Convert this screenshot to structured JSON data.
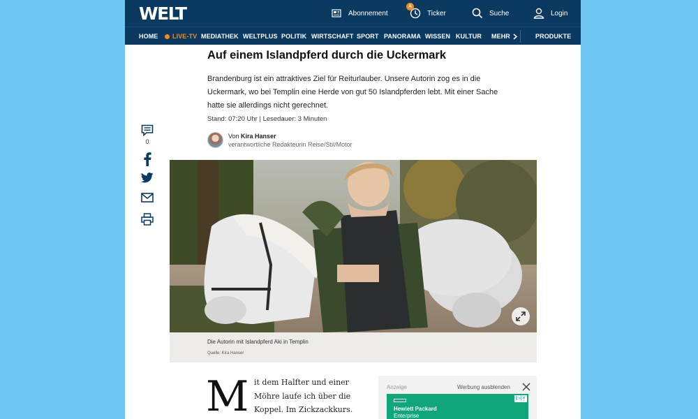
{
  "header": {
    "logo": "WELT",
    "abo_label": "Abonnement",
    "ticker_label": "Ticker",
    "ticker_badge": "A",
    "search_label": "Suche",
    "login_label": "Login"
  },
  "nav": {
    "items": [
      "HOME",
      "LIVE-TV",
      "MEDIATHEK",
      "WELTPLUS",
      "POLITIK",
      "WIRTSCHAFT",
      "SPORT",
      "PANORAMA",
      "WISSEN",
      "KULTUR"
    ],
    "more_label": "MEHR",
    "products_label": "PRODUKTE"
  },
  "article": {
    "headline": "Auf einem Islandpferd durch die Uckermark",
    "intro": "Brandenburg ist ein attraktives Ziel für Reiturlauber. Unsere Autorin zog es in die Uckermark, wo bei Templin eine Herde von gut 50 Islandpferden lebt. Mit einer Sache hatte sie allerdings nicht gerechnet.",
    "meta": "Stand: 07:20 Uhr | Lesedauer: 3 Minuten",
    "author_prefix": "Von",
    "author_name": "Kira Hanser",
    "author_role": "verantwortliche Redakteurin Reise/Stil/Motor",
    "caption": "Die Autorin mit Islandpferd Aki in Templin",
    "credit": "Quelle: Kira Hanser",
    "dropcap": "M",
    "body": "it dem Halfter und einer Möhre laufe ich über die Koppel. Im Zickzackkurs."
  },
  "share": {
    "comment_count": "0"
  },
  "ad": {
    "label": "Anzeige",
    "hide_label": "Werbung ausblenden",
    "brand_line1": "Hewlett Packard",
    "brand_line2": "Enterprise",
    "adchoices": "|▷|✕"
  },
  "colors": {
    "background": "#6fc6f2",
    "header": "#0b3a61",
    "live_accent": "#f28c1c",
    "ad_green": "#0fa77a"
  }
}
